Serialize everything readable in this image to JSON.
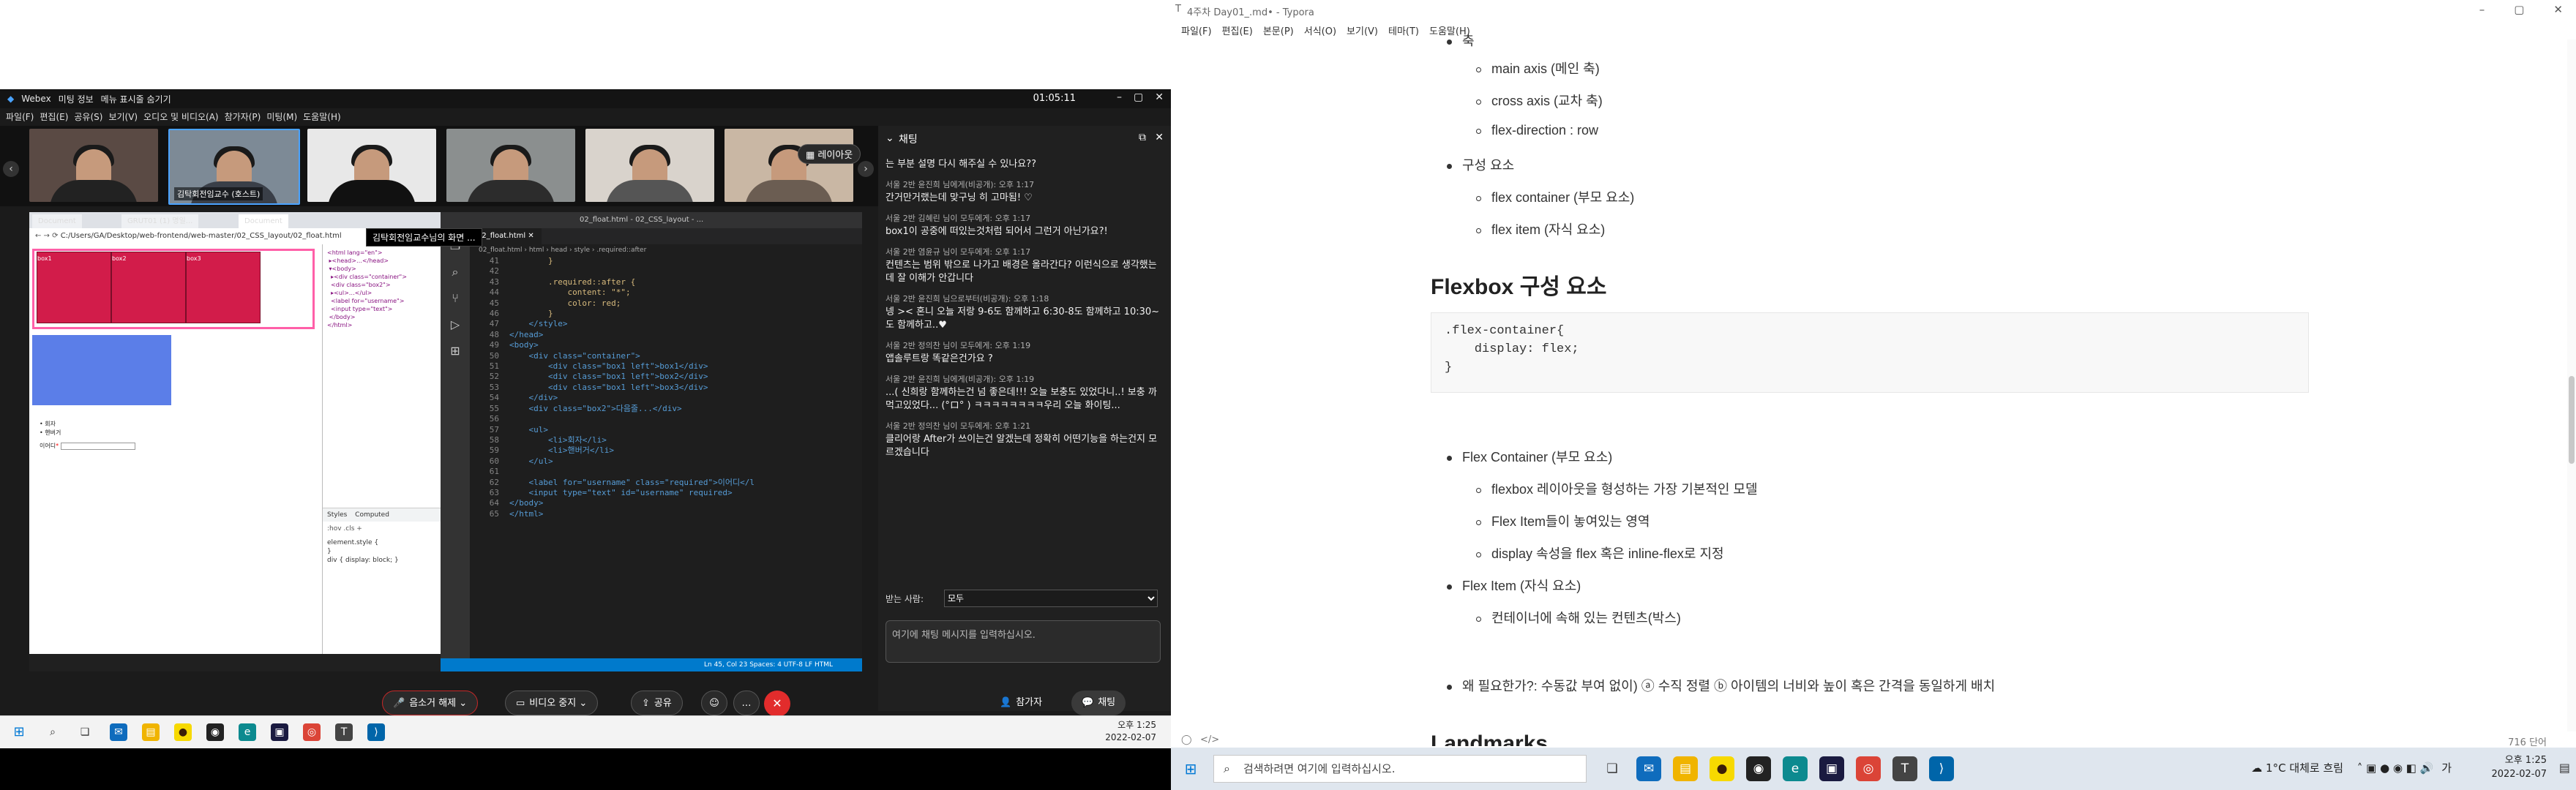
{
  "webex": {
    "app_title": "Webex",
    "meeting_info": "미팅 정보",
    "menu_toggle": "메뉴 표시줄 숨기기",
    "clock": "01:05:11",
    "menu": [
      "파일(F)",
      "편집(E)",
      "공유(S)",
      "보기(V)",
      "오디오 및 비디오(A)",
      "참가자(P)",
      "미팅(M)",
      "도움말(H)"
    ],
    "layout_button": "레이아웃",
    "host_thumb_name": "김탁회전임교수 (호스트)",
    "share_tooltip": "김탁회전임교수님의 화면 ...",
    "controls": {
      "mute": "음소거 해제",
      "video": "비디오 중지",
      "share": "공유",
      "participants": "참가자",
      "chat": "채팅"
    }
  },
  "shared_screen": {
    "browser_tabs": [
      "Document",
      "GRUT01 (1) 명일...",
      "Document"
    ],
    "address": "C:/Users/GA/Desktop/web-frontend/web-master/02_CSS_layout/02_float.html",
    "page_labels": [
      "box1",
      "box2",
      "box3"
    ],
    "list_items": [
      "회자",
      "핸버거"
    ],
    "input_label": "이어디",
    "vscode_title": "02_float.html - 02_CSS_layout - ...",
    "vscode_tab": "02_float.html",
    "vscode_breadcrumb": "02_float.html › html › head › style › .required::after",
    "status_bar": "Ln 45, Col 23   Spaces: 4   UTF-8   LF   HTML",
    "devtools_tabs": [
      "Styles",
      "Computed"
    ],
    "devtools_hint": ":hov .cls +",
    "code_lines": [
      {
        "n": "41",
        "t": "        }"
      },
      {
        "n": "42",
        "t": ""
      },
      {
        "n": "43",
        "t": "        .required::after {"
      },
      {
        "n": "44",
        "t": "            content: \"*\";"
      },
      {
        "n": "45",
        "t": "            color: red;"
      },
      {
        "n": "46",
        "t": "        }"
      },
      {
        "n": "47",
        "t": "    </style>"
      },
      {
        "n": "48",
        "t": "</head>"
      },
      {
        "n": "49",
        "t": "<body>"
      },
      {
        "n": "50",
        "t": "    <div class=\"container\">"
      },
      {
        "n": "51",
        "t": "        <div class=\"box1 left\">box1</div>"
      },
      {
        "n": "52",
        "t": "        <div class=\"box1 left\">box2</div>"
      },
      {
        "n": "53",
        "t": "        <div class=\"box1 left\">box3</div>"
      },
      {
        "n": "54",
        "t": "    </div>"
      },
      {
        "n": "55",
        "t": "    <div class=\"box2\">다음줄...</div>"
      },
      {
        "n": "56",
        "t": ""
      },
      {
        "n": "57",
        "t": "    <ul>"
      },
      {
        "n": "58",
        "t": "        <li>회자</li>"
      },
      {
        "n": "59",
        "t": "        <li>핸버거</li>"
      },
      {
        "n": "60",
        "t": "    </ul>"
      },
      {
        "n": "61",
        "t": ""
      },
      {
        "n": "62",
        "t": "    <label for=\"username\" class=\"required\">이어디</l"
      },
      {
        "n": "63",
        "t": "    <input type=\"text\" id=\"username\" required>"
      },
      {
        "n": "64",
        "t": "</body>"
      },
      {
        "n": "65",
        "t": "</html>"
      }
    ]
  },
  "chat": {
    "title": "채팅",
    "top_partial": "는 부분 설명 다시 해주실 수 있나요??",
    "messages": [
      {
        "meta": "서울 2반 윤진희 님에게(비공개):     오후 1:17",
        "text": "간거만거랬는데 맞구닝 히 고마됨! ♡"
      },
      {
        "meta": "서울 2반 김혜린 님이 모두에게:     오후 1:17",
        "text": "box1이 공중에 떠있는것처럼 되어서 그런거 아닌가요?!"
      },
      {
        "meta": "서울 2반 염윤규 님이 모두에게:     오후 1:17",
        "text": "컨텐츠는 범위 밖으로 나가고 배경은 올라간다? 이런식으로 생각했는데 잘 이해가 안갑니다"
      },
      {
        "meta": "서울 2반 윤진희 님으로부터(비공개):     오후 1:18",
        "text": "넹 >< 혼니 오늘 저랑 9-6도 함께하고 6:30-8도 함께하고 10:30~도 함께하고..♥"
      },
      {
        "meta": "서울 2반 정의찬 님이 모두에게:     오후 1:19",
        "text": "앱솔루트랑 똑같은건가요 ?"
      },
      {
        "meta": "서울 2반 윤진희 님에게(비공개):     오후 1:19",
        "text": "...( 신희랑 함께하는건 넘 좋은데!!! 오늘 보충도 있었다니..! 보충 까먹고있었다... (°ロ° ) ㅋㅋㅋㅋㅋㅋㅋㅋ우리 오늘 화이팅..."
      },
      {
        "meta": "서울 2반 정의찬 님이 모두에게:     오후 1:21",
        "text": "클리어랑 After가 쓰이는건 알겠는데 정확히 어떤기능을 하는건지 모르겠습니다"
      }
    ],
    "to_label": "받는 사람:",
    "to_value": "모두",
    "input_placeholder": "여기에 채팅 메시지를 입력하십시오."
  },
  "left_taskbar": {
    "time": "오후 1:25",
    "date": "2022-02-07"
  },
  "typora": {
    "title": "4주차 Day01_.md• - Typora",
    "menu": [
      "파일(F)",
      "편집(E)",
      "본문(P)",
      "서식(O)",
      "보기(V)",
      "테마(T)",
      "도움말(H)"
    ],
    "doc": {
      "axis_bullet": "축",
      "axis_items": [
        "main axis (메인 축)",
        "cross axis (교차 축)",
        "flex-direction : row"
      ],
      "comp_bullet": "구성 요소",
      "comp_items": [
        "flex container (부모 요소)",
        "flex item (자식 요소)"
      ],
      "heading": "Flexbox 구성 요소",
      "code": ".flex-container{\n    display: flex;\n}",
      "container_bullet": "Flex Container (부모 요소)",
      "container_items": [
        "flexbox 레이아웃을 형성하는 가장 기본적인 모델",
        "Flex Item들이 놓여있는 영역",
        "display 속성을 flex 혹은 inline-flex로 지정"
      ],
      "item_bullet": "Flex Item (자식 요소)",
      "item_items": [
        "컨테이너에 속해 있는 컨텐츠(박스)"
      ],
      "why": "왜 필요한가?: 수동값 부여 없이) ⓐ 수직 정렬 ⓑ 아이템의 너비와 높이 혹은 간격을 동일하게 배치",
      "partial_heading": "Landmarks"
    },
    "word_count": "716 단어"
  },
  "right_taskbar": {
    "search_placeholder": "검색하려면 여기에 입력하십시오.",
    "weather": "1°C  대체로 흐림",
    "ime": "가",
    "time": "오후 1:25",
    "date": "2022-02-07"
  },
  "colors": {
    "webex_bg": "#1b1b1b",
    "end_call": "#e22c2c",
    "vscode_status": "#007acc",
    "css_red_box": "#d21c4a",
    "css_blue_box": "#5b7ee8"
  }
}
